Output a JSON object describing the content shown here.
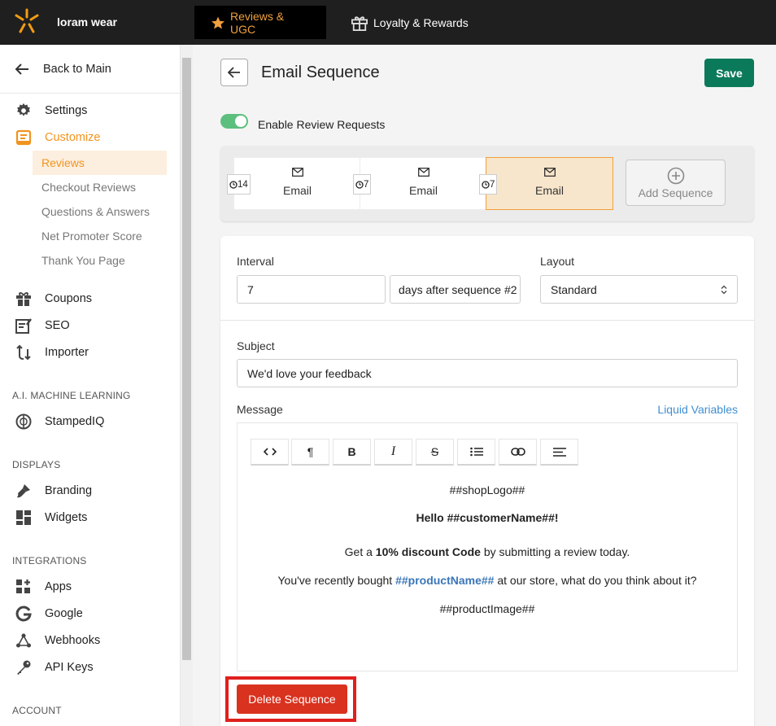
{
  "topbar": {
    "brand": "loram wear",
    "tabs": [
      {
        "label": "Reviews & UGC",
        "active": true
      },
      {
        "label": "Loyalty & Rewards",
        "active": false
      }
    ],
    "accent": "#f0a03c"
  },
  "sidebar": {
    "back_label": "Back to Main",
    "settings": "Settings",
    "customize": "Customize",
    "customize_items": [
      "Reviews",
      "Checkout Reviews",
      "Questions & Answers",
      "Net Promoter Score",
      "Thank You Page"
    ],
    "coupons": "Coupons",
    "seo": "SEO",
    "importer": "Importer",
    "section_ai": "A.I. MACHINE LEARNING",
    "stampediq": "StampedIQ",
    "section_displays": "DISPLAYS",
    "branding": "Branding",
    "widgets": "Widgets",
    "section_integrations": "INTEGRATIONS",
    "apps": "Apps",
    "google": "Google",
    "webhooks": "Webhooks",
    "api_keys": "API Keys",
    "section_account": "ACCOUNT"
  },
  "header": {
    "title": "Email Sequence",
    "save_label": "Save"
  },
  "toggle": {
    "label": "Enable Review Requests",
    "enabled": true
  },
  "sequence": {
    "cards": [
      {
        "delay": "14",
        "label": "Email",
        "active": false
      },
      {
        "delay": "7",
        "label": "Email",
        "active": false
      },
      {
        "delay": "7",
        "label": "Email",
        "active": true
      }
    ],
    "add_label": "Add Sequence"
  },
  "form": {
    "interval_label": "Interval",
    "interval_value": "7",
    "interval_unit": "days after sequence #2",
    "layout_label": "Layout",
    "layout_value": "Standard",
    "subject_label": "Subject",
    "subject_value": "We'd love your feedback",
    "message_label": "Message",
    "liquid_link": "Liquid Variables",
    "toolbar": [
      "code",
      "paragraph",
      "bold",
      "italic",
      "strikethrough",
      "list",
      "link",
      "align"
    ],
    "message": {
      "logo": "##shopLogo##",
      "greeting": "Hello ##customerName##!",
      "discount_pre": "Get a ",
      "discount_bold": "10% discount Code",
      "discount_post": " by submitting a review today.",
      "bought_pre": "You've recently bought ",
      "bought_var": "##productName##",
      "bought_post": " at our store, what do you think about it?",
      "image": "##productImage##"
    },
    "delete_label": "Delete Sequence"
  }
}
